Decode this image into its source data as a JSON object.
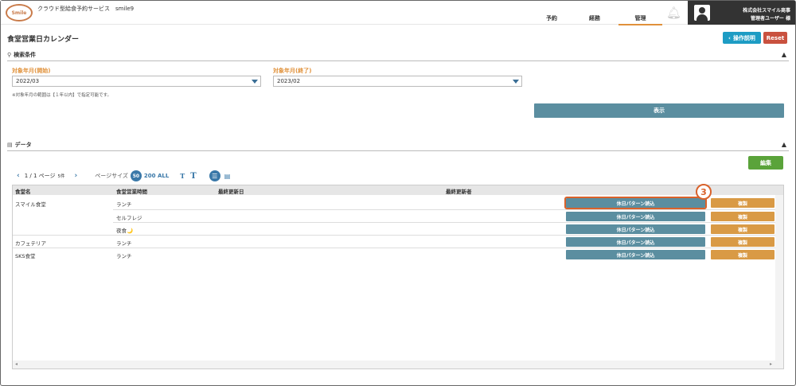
{
  "header": {
    "logo_text": "Smile",
    "service_name": "クラウド型給食予約サービス　smile9",
    "nav": [
      {
        "label": "予約"
      },
      {
        "label": "経務"
      },
      {
        "label": "管理",
        "active": true
      }
    ],
    "user_company": "株式会社スマイル商事",
    "user_name": "管理者ユーザー 様"
  },
  "page": {
    "title": "食堂営業日カレンダー",
    "help_label": "操作説明",
    "reset_label": "Reset"
  },
  "search": {
    "section_title": "検索条件",
    "start_label": "対象年月(開始)",
    "start_value": "2022/03",
    "end_label": "対象年月(終了)",
    "end_value": "2023/02",
    "note": "※対象年月の範囲は【１年以内】で指定可能です。",
    "show_label": "表示"
  },
  "data_section": {
    "title": "データ",
    "edit_label": "編集",
    "pager": {
      "page_text": "1 / 1 ページ",
      "count_text": "5件",
      "page_size_label": "ページサイズ",
      "page_size_selected": "50",
      "page_size_options": "200 ALL"
    },
    "columns": [
      "食堂名",
      "食堂営業時間",
      "最終更新日",
      "最終更新者"
    ],
    "rows": [
      {
        "name": "スマイル食堂",
        "time": "ランチ",
        "updated": "",
        "updater": ""
      },
      {
        "name": "",
        "time": "セルフレジ",
        "updated": "",
        "updater": ""
      },
      {
        "name": "",
        "time": "夜食🌙",
        "updated": "",
        "updater": ""
      },
      {
        "name": "カフェテリア",
        "time": "ランチ",
        "updated": "",
        "updater": ""
      },
      {
        "name": "SKS食堂",
        "time": "ランチ",
        "updated": "",
        "updater": ""
      }
    ],
    "pattern_label": "休日パターン読込",
    "copy_label": "複製"
  },
  "callout": {
    "number": "3"
  },
  "colors": {
    "accent_orange": "#e0913a",
    "teal_button": "#5b8ea0",
    "copy_button": "#d99a45",
    "help_button": "#1d9cc4",
    "reset_button": "#c9513f",
    "edit_button": "#5aa33a",
    "highlight": "#d9622b"
  }
}
